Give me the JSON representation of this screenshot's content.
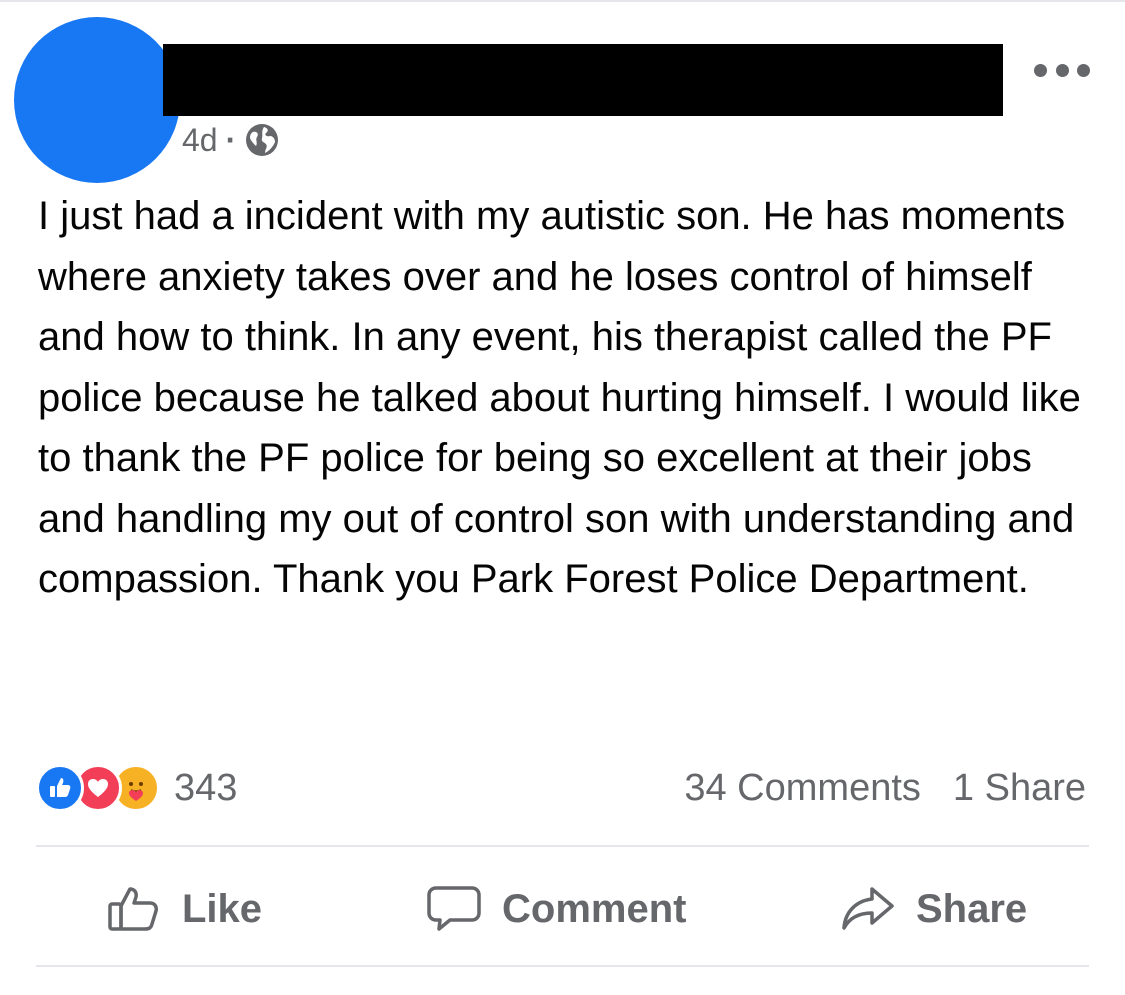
{
  "post": {
    "timestamp": "4d",
    "separator": "·",
    "privacy_icon": "globe-icon",
    "body": "I just had a incident with my autistic son. He has moments where anxiety takes over and he loses control of himself and how to think. In any event, his therapist called the PF police because he talked about hurting himself. I would like to thank the PF police for being so excellent at their jobs and handling my out of control son with understanding and compassion. Thank you Park Forest Police Department."
  },
  "engagement": {
    "reaction_icons": [
      "like-reaction-icon",
      "love-reaction-icon",
      "care-reaction-icon"
    ],
    "reaction_count": "343",
    "comments": "34 Comments",
    "shares": "1 Share"
  },
  "actions": {
    "like_label": "Like",
    "comment_label": "Comment",
    "share_label": "Share"
  },
  "colors": {
    "avatar": "#1877f2",
    "like_reaction": "#1877f2",
    "love_reaction": "#f33e58",
    "care_reaction": "#f7b125",
    "secondary_text": "#65676b",
    "body_text": "#050505",
    "divider": "#e4e6eb"
  }
}
